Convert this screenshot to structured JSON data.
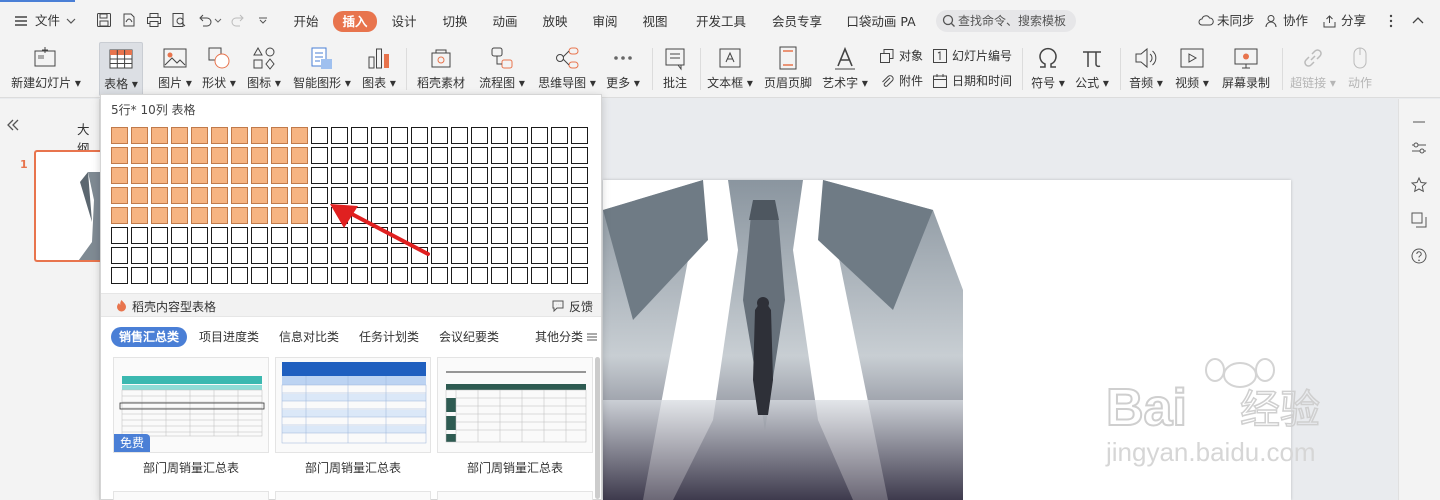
{
  "menubar": {
    "file": "文件",
    "tabs": [
      "开始",
      "插入",
      "设计",
      "切换",
      "动画",
      "放映",
      "审阅",
      "视图",
      "开发工具",
      "会员专享",
      "口袋动画 PA"
    ],
    "active_tab": "插入",
    "search_placeholder": "查找命令、搜索模板",
    "unsynced": "未同步",
    "collab": "协作",
    "share": "分享"
  },
  "ribbon": {
    "new_slide": "新建幻灯片",
    "table": "表格",
    "picture": "图片",
    "shape": "形状",
    "icon": "图标",
    "smart_graphic": "智能图形",
    "chart": "图表",
    "daoke": "稻壳素材",
    "flowchart": "流程图",
    "mindmap": "思维导图",
    "more": "更多",
    "comment": "批注",
    "textbox": "文本框",
    "header_footer": "页眉页脚",
    "wordart": "艺术字",
    "object": "对象",
    "slide_number": "幻灯片编号",
    "attachment": "附件",
    "datetime": "日期和时间",
    "symbol": "符号",
    "formula": "公式",
    "audio": "音频",
    "video": "视频",
    "screen_record": "屏幕录制",
    "hyperlink": "超链接",
    "action": "动作"
  },
  "left": {
    "outline": "大纲",
    "slide_num": "1"
  },
  "table_picker": {
    "title": "5行* 10列 表格",
    "rows": 8,
    "cols": 24,
    "selected_rows": 5,
    "selected_cols": 10,
    "footer_left": "稻壳内容型表格",
    "footer_right": "反馈",
    "categories": [
      "销售汇总类",
      "项目进度类",
      "信息对比类",
      "任务计划类",
      "会议纪要类",
      "其他分类"
    ],
    "active_category": "销售汇总类",
    "templates": [
      {
        "caption": "部门周销量汇总表",
        "badge": "免费"
      },
      {
        "caption": "部门周销量汇总表",
        "badge": ""
      },
      {
        "caption": "部门周销量汇总表",
        "badge": ""
      }
    ]
  },
  "watermark": {
    "brand": "Bai",
    "brand2": "经验",
    "url": "jingyan.baidu.com"
  },
  "colors": {
    "accent": "#e8744d",
    "cell_selected": "#f6b482",
    "blue": "#4a7fd6",
    "arrow": "#e02020"
  }
}
